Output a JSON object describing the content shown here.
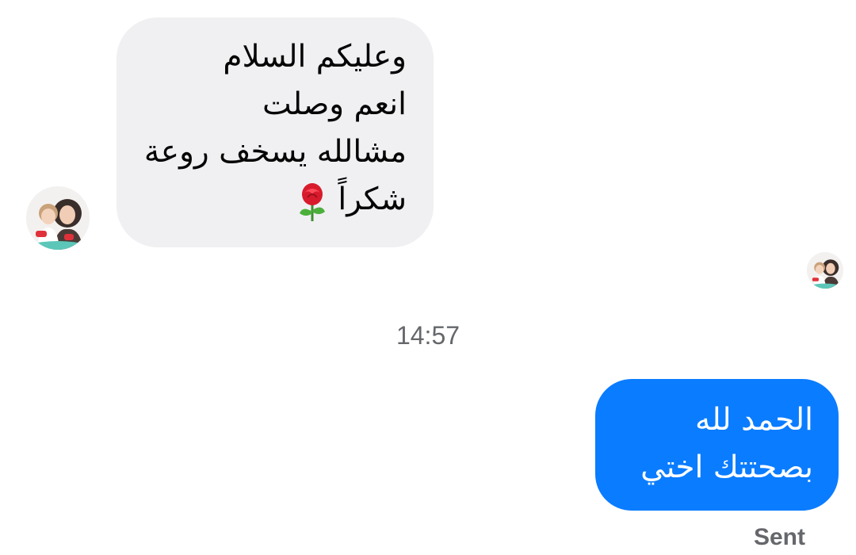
{
  "messages": {
    "received": {
      "lines": [
        "وعليكم السلام",
        "انعم وصلت",
        "مشالله يسخف روعة",
        "شكراً"
      ],
      "emoji": "rose-icon"
    },
    "sent": {
      "lines": [
        "الحمد لله",
        "بصحتتك اختي"
      ]
    }
  },
  "timestamp": "14:57",
  "status": "Sent",
  "colors": {
    "sent_bubble": "#0a7cff",
    "received_bubble": "#f0f0f3",
    "meta_text": "#65676b"
  }
}
